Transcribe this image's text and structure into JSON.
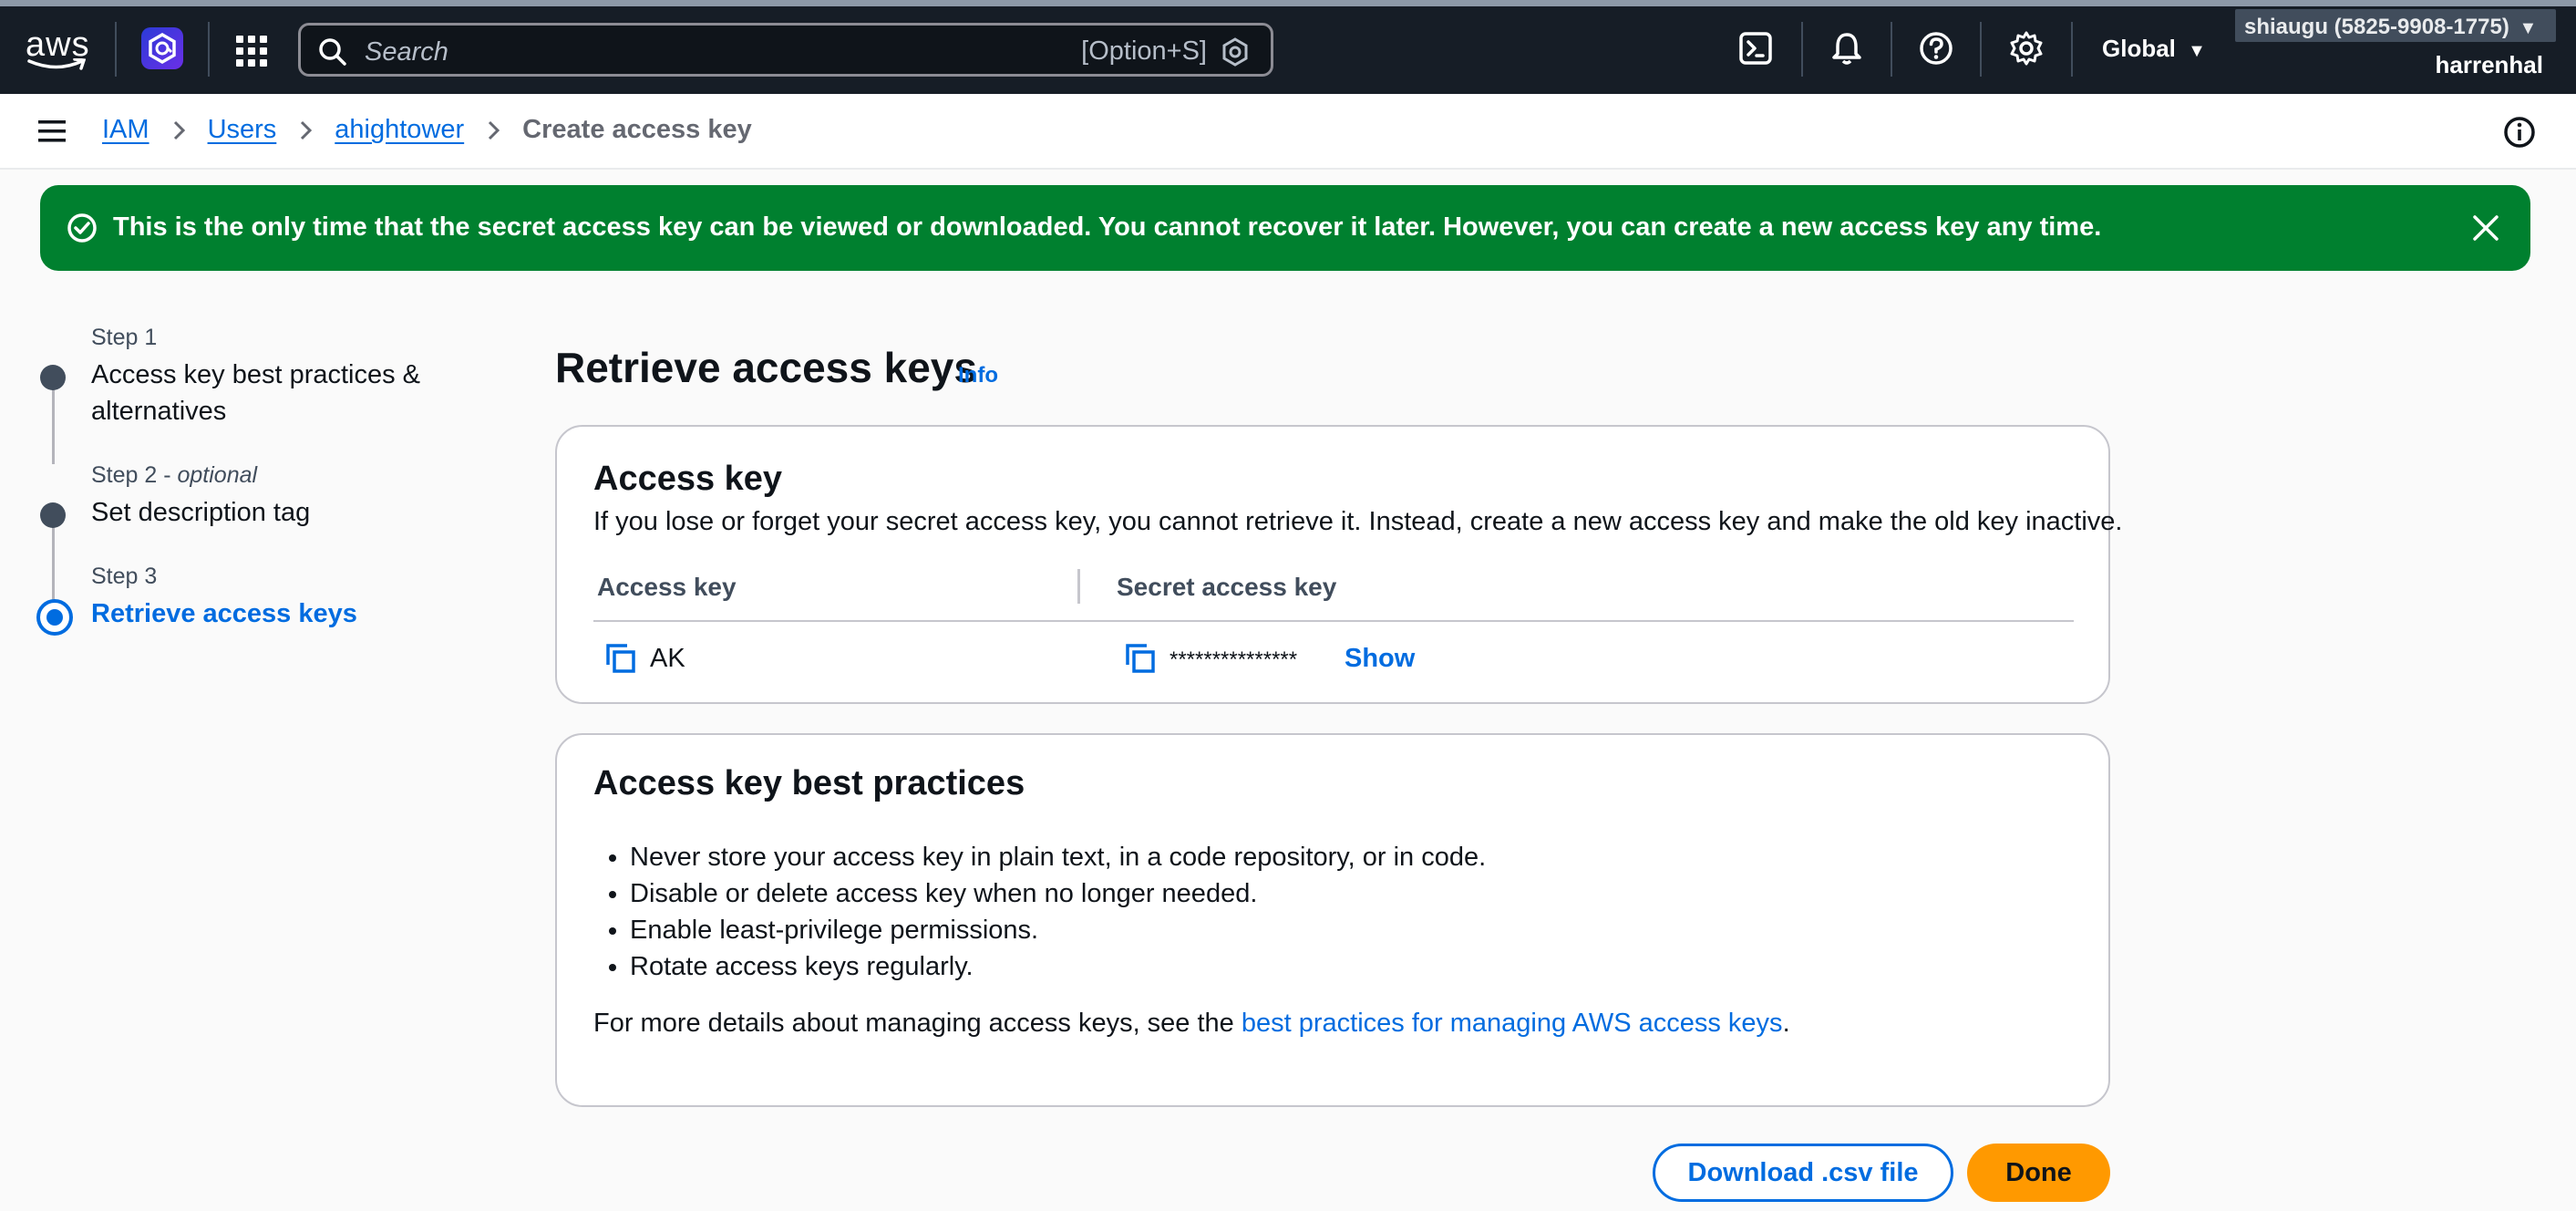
{
  "topnav": {
    "logo_text": "aws",
    "search_placeholder": "Search",
    "search_shortcut": "[Option+S]",
    "region": "Global",
    "account": "shiaugu (5825-9908-1775)",
    "user": "harrenhal",
    "icons": [
      "cloudshell-icon",
      "bell-icon",
      "help-icon",
      "gear-icon"
    ]
  },
  "breadcrumb": {
    "items": [
      "IAM",
      "Users",
      "ahightower"
    ],
    "current": "Create access key"
  },
  "flash": {
    "message": "This is the only time that the secret access key can be viewed or downloaded. You cannot recover it later. However, you can create a new access key any time.",
    "color": "#00802f"
  },
  "steps": [
    {
      "label": "Step 1",
      "optional": "",
      "title_line1": "Access key best practices &",
      "title_line2": "alternatives",
      "state": "completed"
    },
    {
      "label": "Step 2 - ",
      "optional": "optional",
      "title_line1": "Set description tag",
      "title_line2": "",
      "state": "completed"
    },
    {
      "label": "Step 3",
      "optional": "",
      "title_line1": "Retrieve access keys",
      "title_line2": "",
      "state": "active"
    }
  ],
  "page": {
    "title": "Retrieve access keys",
    "info": "Info"
  },
  "access_key_card": {
    "title": "Access key",
    "description": "If you lose or forget your secret access key, you cannot retrieve it. Instead, create a new access key and make the old key inactive.",
    "columns": [
      "Access key",
      "Secret access key"
    ],
    "access_key_value": "AK",
    "secret_value": "***************",
    "show_label": "Show"
  },
  "best_practices_card": {
    "title": "Access key best practices",
    "items": [
      "Never store your access key in plain text, in a code repository, or in code.",
      "Disable or delete access key when no longer needed.",
      "Enable least-privilege permissions.",
      "Rotate access keys regularly."
    ],
    "more_prefix": "For more details about managing access keys, see the ",
    "more_link": "best practices for managing AWS access keys",
    "more_suffix": "."
  },
  "actions": {
    "download": "Download .csv file",
    "done": "Done"
  },
  "colors": {
    "accent": "#006ce0",
    "primary_button": "#ff9900",
    "nav_bg": "#161d26",
    "success": "#00802f"
  }
}
